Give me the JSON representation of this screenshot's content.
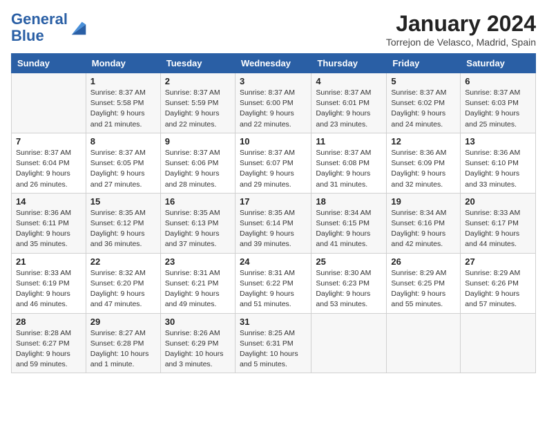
{
  "header": {
    "logo_general": "General",
    "logo_blue": "Blue",
    "month": "January 2024",
    "location": "Torrejon de Velasco, Madrid, Spain"
  },
  "days_of_week": [
    "Sunday",
    "Monday",
    "Tuesday",
    "Wednesday",
    "Thursday",
    "Friday",
    "Saturday"
  ],
  "weeks": [
    [
      {
        "day": "",
        "sunrise": "",
        "sunset": "",
        "daylight": ""
      },
      {
        "day": "1",
        "sunrise": "Sunrise: 8:37 AM",
        "sunset": "Sunset: 5:58 PM",
        "daylight": "Daylight: 9 hours and 21 minutes."
      },
      {
        "day": "2",
        "sunrise": "Sunrise: 8:37 AM",
        "sunset": "Sunset: 5:59 PM",
        "daylight": "Daylight: 9 hours and 22 minutes."
      },
      {
        "day": "3",
        "sunrise": "Sunrise: 8:37 AM",
        "sunset": "Sunset: 6:00 PM",
        "daylight": "Daylight: 9 hours and 22 minutes."
      },
      {
        "day": "4",
        "sunrise": "Sunrise: 8:37 AM",
        "sunset": "Sunset: 6:01 PM",
        "daylight": "Daylight: 9 hours and 23 minutes."
      },
      {
        "day": "5",
        "sunrise": "Sunrise: 8:37 AM",
        "sunset": "Sunset: 6:02 PM",
        "daylight": "Daylight: 9 hours and 24 minutes."
      },
      {
        "day": "6",
        "sunrise": "Sunrise: 8:37 AM",
        "sunset": "Sunset: 6:03 PM",
        "daylight": "Daylight: 9 hours and 25 minutes."
      }
    ],
    [
      {
        "day": "7",
        "sunrise": "Sunrise: 8:37 AM",
        "sunset": "Sunset: 6:04 PM",
        "daylight": "Daylight: 9 hours and 26 minutes."
      },
      {
        "day": "8",
        "sunrise": "Sunrise: 8:37 AM",
        "sunset": "Sunset: 6:05 PM",
        "daylight": "Daylight: 9 hours and 27 minutes."
      },
      {
        "day": "9",
        "sunrise": "Sunrise: 8:37 AM",
        "sunset": "Sunset: 6:06 PM",
        "daylight": "Daylight: 9 hours and 28 minutes."
      },
      {
        "day": "10",
        "sunrise": "Sunrise: 8:37 AM",
        "sunset": "Sunset: 6:07 PM",
        "daylight": "Daylight: 9 hours and 29 minutes."
      },
      {
        "day": "11",
        "sunrise": "Sunrise: 8:37 AM",
        "sunset": "Sunset: 6:08 PM",
        "daylight": "Daylight: 9 hours and 31 minutes."
      },
      {
        "day": "12",
        "sunrise": "Sunrise: 8:36 AM",
        "sunset": "Sunset: 6:09 PM",
        "daylight": "Daylight: 9 hours and 32 minutes."
      },
      {
        "day": "13",
        "sunrise": "Sunrise: 8:36 AM",
        "sunset": "Sunset: 6:10 PM",
        "daylight": "Daylight: 9 hours and 33 minutes."
      }
    ],
    [
      {
        "day": "14",
        "sunrise": "Sunrise: 8:36 AM",
        "sunset": "Sunset: 6:11 PM",
        "daylight": "Daylight: 9 hours and 35 minutes."
      },
      {
        "day": "15",
        "sunrise": "Sunrise: 8:35 AM",
        "sunset": "Sunset: 6:12 PM",
        "daylight": "Daylight: 9 hours and 36 minutes."
      },
      {
        "day": "16",
        "sunrise": "Sunrise: 8:35 AM",
        "sunset": "Sunset: 6:13 PM",
        "daylight": "Daylight: 9 hours and 37 minutes."
      },
      {
        "day": "17",
        "sunrise": "Sunrise: 8:35 AM",
        "sunset": "Sunset: 6:14 PM",
        "daylight": "Daylight: 9 hours and 39 minutes."
      },
      {
        "day": "18",
        "sunrise": "Sunrise: 8:34 AM",
        "sunset": "Sunset: 6:15 PM",
        "daylight": "Daylight: 9 hours and 41 minutes."
      },
      {
        "day": "19",
        "sunrise": "Sunrise: 8:34 AM",
        "sunset": "Sunset: 6:16 PM",
        "daylight": "Daylight: 9 hours and 42 minutes."
      },
      {
        "day": "20",
        "sunrise": "Sunrise: 8:33 AM",
        "sunset": "Sunset: 6:17 PM",
        "daylight": "Daylight: 9 hours and 44 minutes."
      }
    ],
    [
      {
        "day": "21",
        "sunrise": "Sunrise: 8:33 AM",
        "sunset": "Sunset: 6:19 PM",
        "daylight": "Daylight: 9 hours and 46 minutes."
      },
      {
        "day": "22",
        "sunrise": "Sunrise: 8:32 AM",
        "sunset": "Sunset: 6:20 PM",
        "daylight": "Daylight: 9 hours and 47 minutes."
      },
      {
        "day": "23",
        "sunrise": "Sunrise: 8:31 AM",
        "sunset": "Sunset: 6:21 PM",
        "daylight": "Daylight: 9 hours and 49 minutes."
      },
      {
        "day": "24",
        "sunrise": "Sunrise: 8:31 AM",
        "sunset": "Sunset: 6:22 PM",
        "daylight": "Daylight: 9 hours and 51 minutes."
      },
      {
        "day": "25",
        "sunrise": "Sunrise: 8:30 AM",
        "sunset": "Sunset: 6:23 PM",
        "daylight": "Daylight: 9 hours and 53 minutes."
      },
      {
        "day": "26",
        "sunrise": "Sunrise: 8:29 AM",
        "sunset": "Sunset: 6:25 PM",
        "daylight": "Daylight: 9 hours and 55 minutes."
      },
      {
        "day": "27",
        "sunrise": "Sunrise: 8:29 AM",
        "sunset": "Sunset: 6:26 PM",
        "daylight": "Daylight: 9 hours and 57 minutes."
      }
    ],
    [
      {
        "day": "28",
        "sunrise": "Sunrise: 8:28 AM",
        "sunset": "Sunset: 6:27 PM",
        "daylight": "Daylight: 9 hours and 59 minutes."
      },
      {
        "day": "29",
        "sunrise": "Sunrise: 8:27 AM",
        "sunset": "Sunset: 6:28 PM",
        "daylight": "Daylight: 10 hours and 1 minute."
      },
      {
        "day": "30",
        "sunrise": "Sunrise: 8:26 AM",
        "sunset": "Sunset: 6:29 PM",
        "daylight": "Daylight: 10 hours and 3 minutes."
      },
      {
        "day": "31",
        "sunrise": "Sunrise: 8:25 AM",
        "sunset": "Sunset: 6:31 PM",
        "daylight": "Daylight: 10 hours and 5 minutes."
      },
      {
        "day": "",
        "sunrise": "",
        "sunset": "",
        "daylight": ""
      },
      {
        "day": "",
        "sunrise": "",
        "sunset": "",
        "daylight": ""
      },
      {
        "day": "",
        "sunrise": "",
        "sunset": "",
        "daylight": ""
      }
    ]
  ]
}
